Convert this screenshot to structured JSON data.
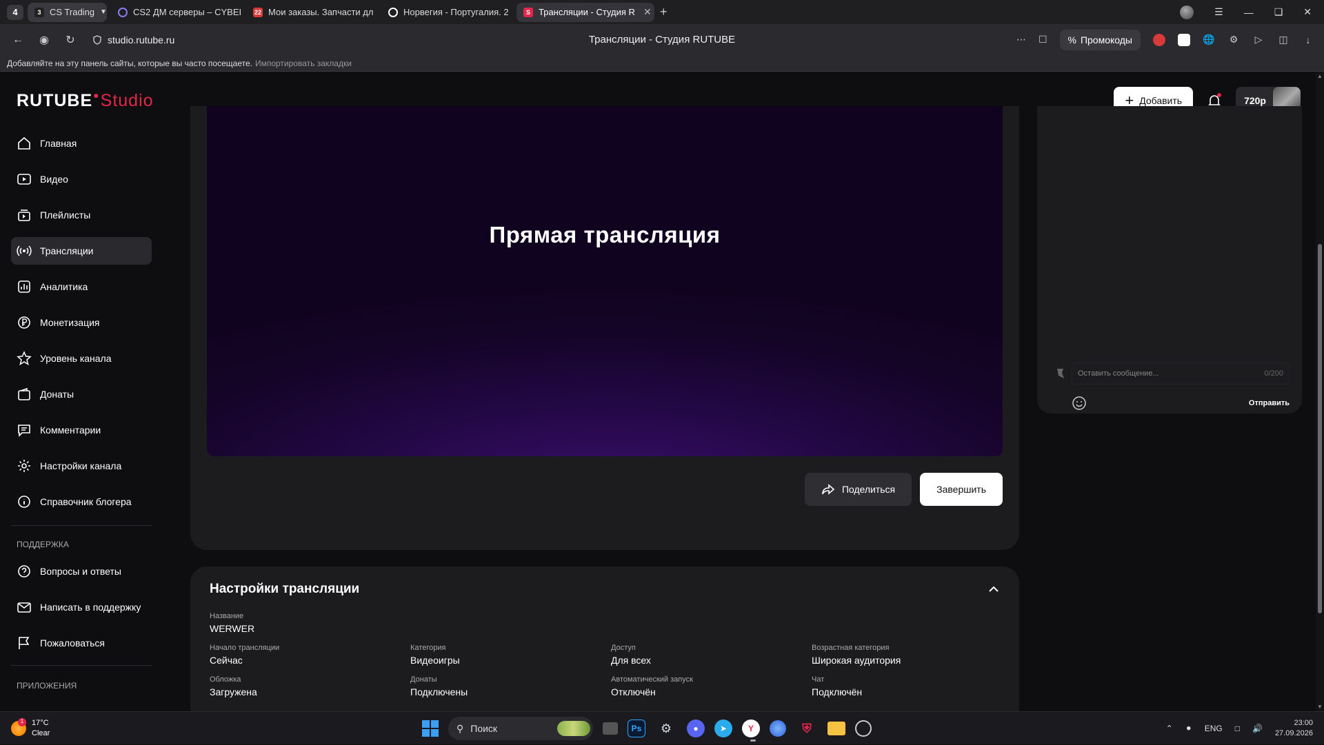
{
  "browser": {
    "tab_group_count": "4",
    "tabs": [
      {
        "label": "CS Trading",
        "badge": "3",
        "color": "#3a3a3e"
      },
      {
        "label": "CS2 ДМ серверы – CYBEI",
        "color": "#5a4bd6"
      },
      {
        "label": "Мои заказы. Запчасти дл",
        "color": "#d83a3a"
      },
      {
        "label": "Норвегия - Португалия. 2",
        "color": "#ffffff"
      },
      {
        "label": "Трансляции - Студия R",
        "color": "#e3264a"
      }
    ],
    "url": "studio.rutube.ru",
    "page_title": "Трансляции - Студия RUTUBE",
    "promo_label": "Промокоды",
    "bookmarks_hint": "Добавляйте на эту панель сайты, которые вы часто посещаете.",
    "bookmarks_import": "Импортировать закладки"
  },
  "header": {
    "logo_main": "RUTUBE",
    "logo_studio": "Studio",
    "add_label": "Добавить",
    "resolution": "720p"
  },
  "sidebar": {
    "items": [
      {
        "label": "Главная",
        "icon": "home-icon"
      },
      {
        "label": "Видео",
        "icon": "video-icon"
      },
      {
        "label": "Плейлисты",
        "icon": "playlist-icon"
      },
      {
        "label": "Трансляции",
        "icon": "broadcast-icon",
        "active": true
      },
      {
        "label": "Аналитика",
        "icon": "analytics-icon"
      },
      {
        "label": "Монетизация",
        "icon": "ruble-icon"
      },
      {
        "label": "Уровень канала",
        "icon": "star-icon"
      },
      {
        "label": "Донаты",
        "icon": "wallet-icon"
      },
      {
        "label": "Комментарии",
        "icon": "comment-icon"
      },
      {
        "label": "Настройки канала",
        "icon": "gear-icon"
      },
      {
        "label": "Справочник блогера",
        "icon": "info-icon"
      }
    ],
    "support_label": "ПОДДЕРЖКА",
    "support_items": [
      {
        "label": "Вопросы и ответы",
        "icon": "question-icon"
      },
      {
        "label": "Написать в поддержку",
        "icon": "mail-icon"
      },
      {
        "label": "Пожаловаться",
        "icon": "flag-icon"
      }
    ],
    "apps_label": "ПРИЛОЖЕНИЯ"
  },
  "player": {
    "title": "Прямая трансляция",
    "share_label": "Поделиться",
    "finish_label": "Завершить"
  },
  "settings": {
    "title": "Настройки трансляции",
    "name_label": "Название",
    "name_value": "WERWER",
    "fields": [
      {
        "label": "Начало трансляции",
        "value": "Сейчас"
      },
      {
        "label": "Категория",
        "value": "Видеоигры"
      },
      {
        "label": "Доступ",
        "value": "Для всех"
      },
      {
        "label": "Возрастная категория",
        "value": "Широкая аудитория"
      },
      {
        "label": "Обложка",
        "value": "Загружена"
      },
      {
        "label": "Донаты",
        "value": "Подключены"
      },
      {
        "label": "Автоматический запуск",
        "value": "Отключён"
      },
      {
        "label": "Чат",
        "value": "Подключён"
      }
    ]
  },
  "chat": {
    "placeholder": "Оставить сообщение...",
    "counter": "0/200",
    "send_label": "Отправить"
  },
  "taskbar": {
    "weather_temp": "17°C",
    "weather_desc": "Clear",
    "weather_badge": "1",
    "search_label": "Поиск",
    "lang": "ENG",
    "time": "23:00",
    "date": "27.09.2026"
  }
}
